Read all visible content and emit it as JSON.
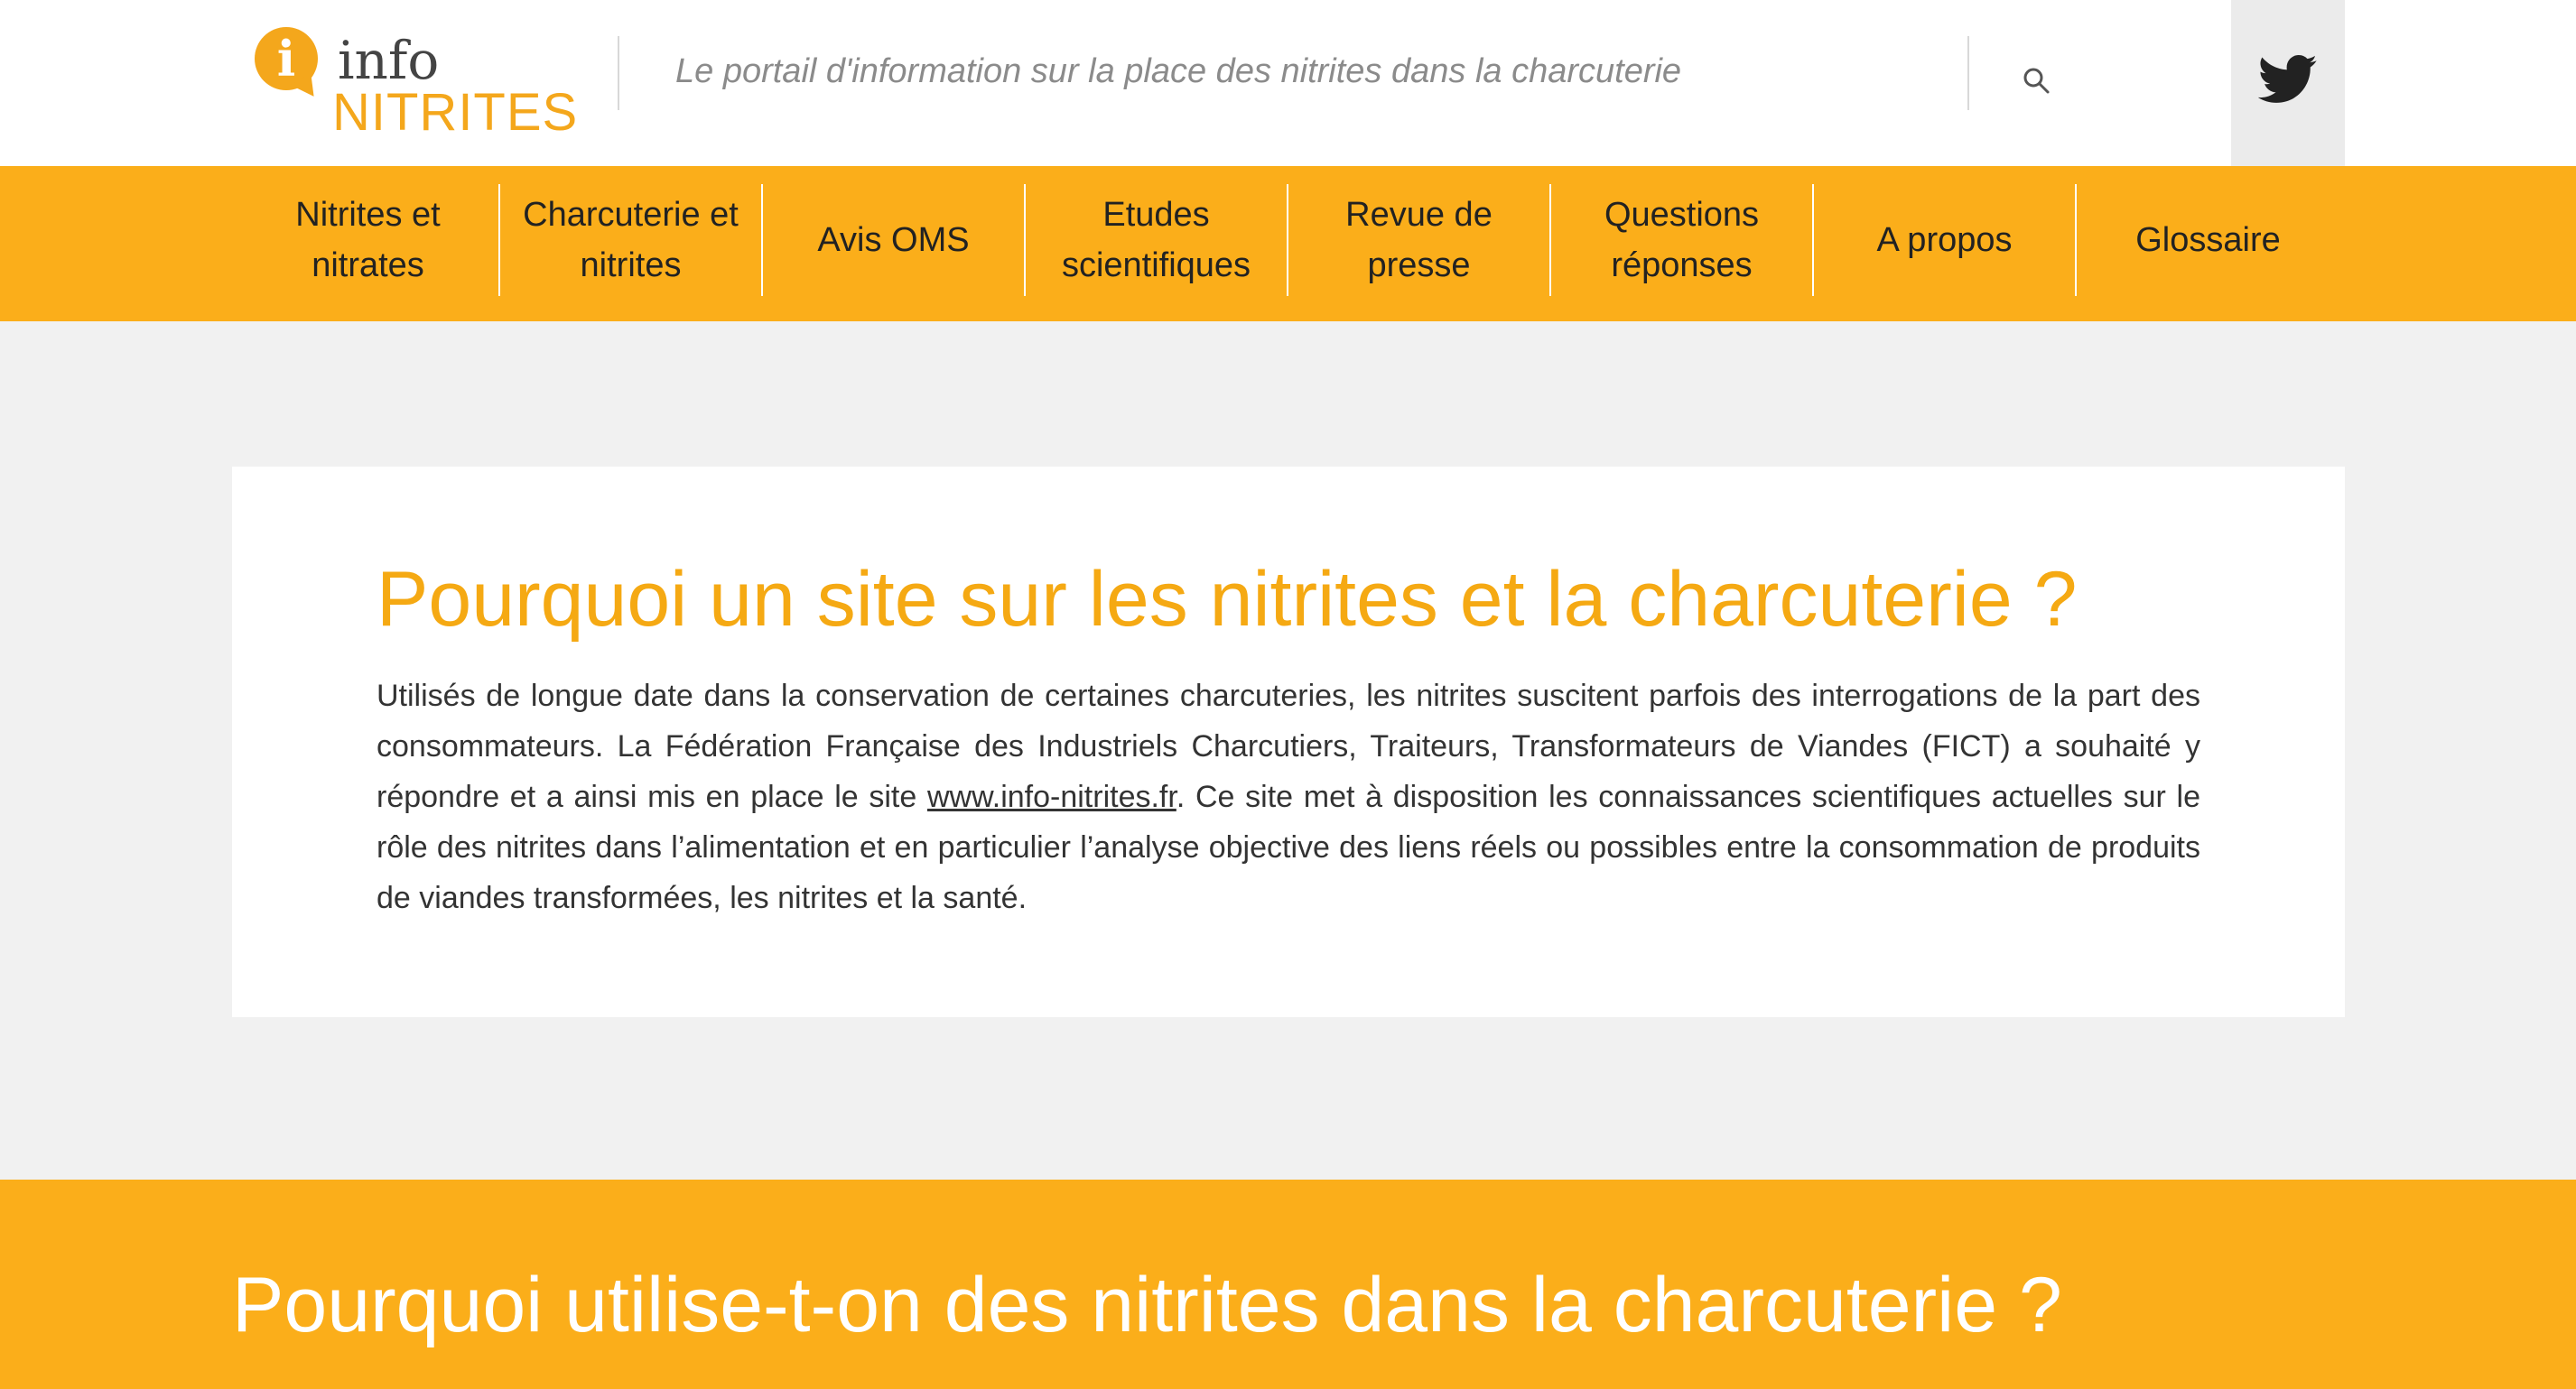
{
  "header": {
    "logo_top": "info",
    "logo_bottom": "NITRITES",
    "tagline": "Le portail d'information sur la place des nitrites dans la charcuterie",
    "search_icon": "search-icon",
    "twitter_icon": "twitter-icon"
  },
  "nav": {
    "items": [
      {
        "label": "Nitrites et nitrates"
      },
      {
        "label": "Charcuterie et nitrites"
      },
      {
        "label": "Avis OMS"
      },
      {
        "label": "Etudes scientifiques"
      },
      {
        "label": "Revue de presse"
      },
      {
        "label": "Questions réponses"
      },
      {
        "label": "A propos"
      },
      {
        "label": "Glossaire"
      }
    ]
  },
  "intro": {
    "title": "Pourquoi un site sur les nitrites et la charcuterie ?",
    "text_before_link": "Utilisés de longue date dans la conservation de certaines charcuteries, les nitrites suscitent parfois des interrogations de la part des consommateurs. La Fédération Française des Industriels Charcutiers, Traiteurs, Transformateurs de Viandes (FICT) a souhaité y répondre et a ainsi mis en place le site ",
    "link_text": "www.info-nitrites.fr",
    "text_after_link": ". Ce site met à disposition les connaissances scientifiques actuelles sur le rôle des nitrites dans l’alimentation et en particulier l’analyse objective des liens réels ou possibles entre la consommation de produits de viandes transformées, les nitrites et la santé."
  },
  "section": {
    "title": "Pourquoi utilise-t-on des nitrites dans la charcuterie ?"
  },
  "colors": {
    "accent": "#fbae1a",
    "title": "#f5a913",
    "background": "#f1f1f1"
  }
}
